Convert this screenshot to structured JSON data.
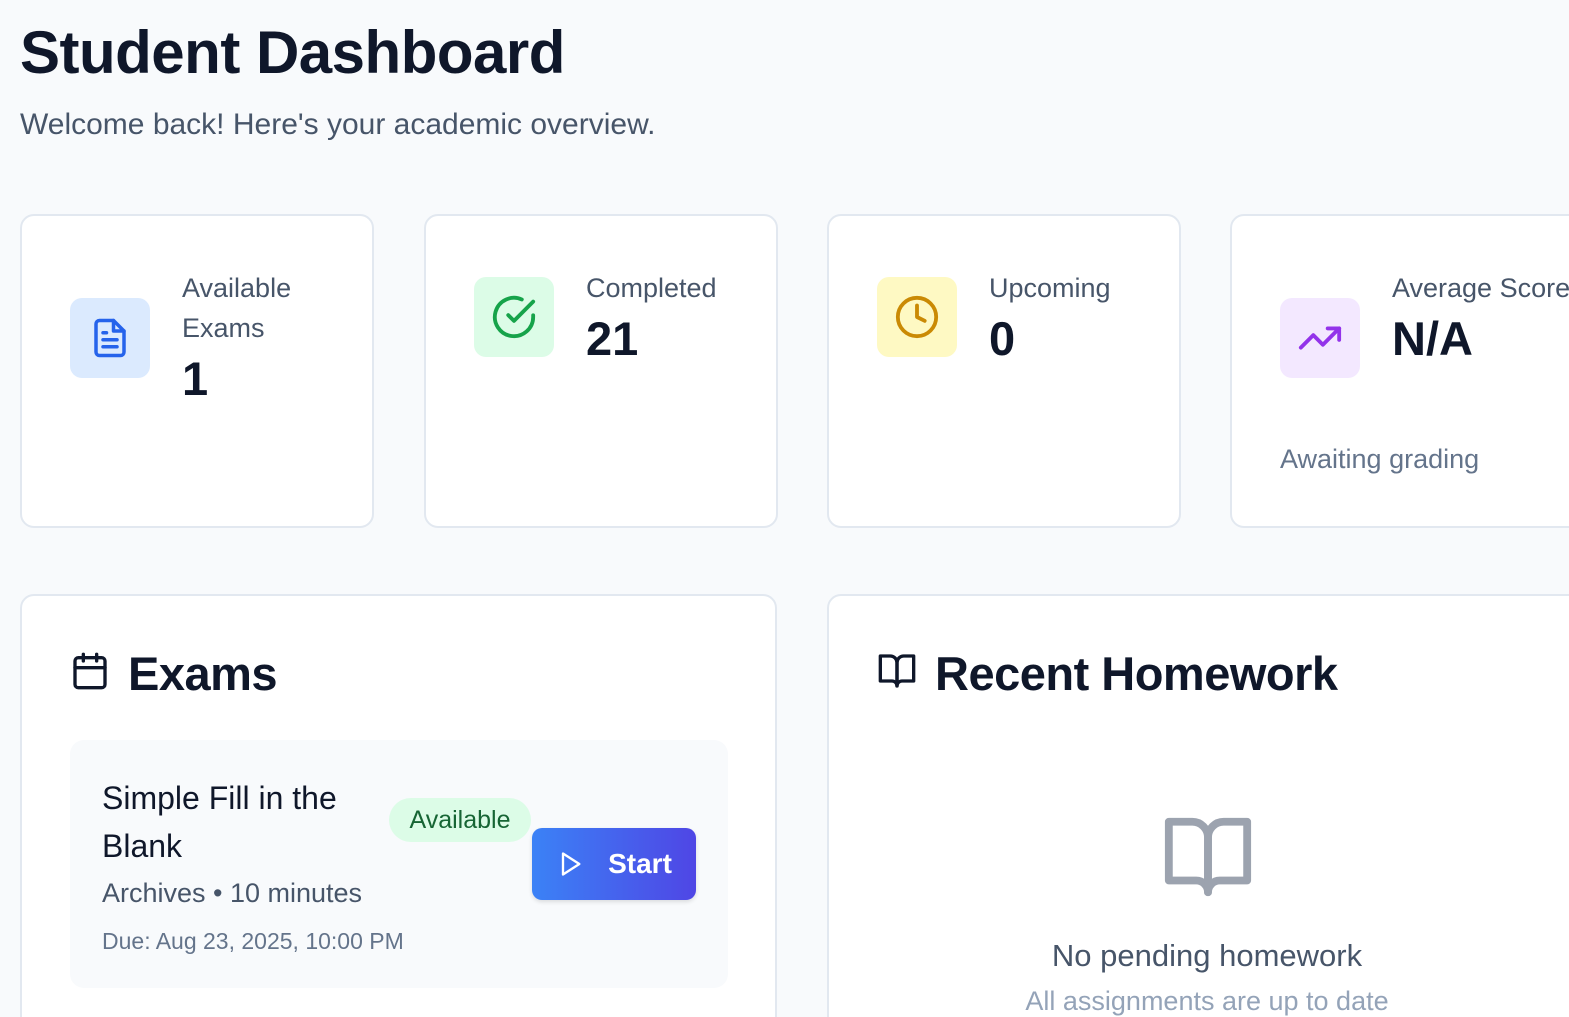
{
  "header": {
    "title": "Student Dashboard",
    "subtitle": "Welcome back! Here's your academic overview."
  },
  "stats": [
    {
      "label": "Available Exams",
      "value": "1",
      "icon": "document-icon",
      "icon_bg": "#dbeafe",
      "icon_color": "#2563eb"
    },
    {
      "label": "Completed",
      "value": "21",
      "icon": "check-circle-icon",
      "icon_bg": "#dcfce7",
      "icon_color": "#16a34a"
    },
    {
      "label": "Upcoming",
      "value": "0",
      "icon": "clock-icon",
      "icon_bg": "#fef9c3",
      "icon_color": "#ca8a04"
    },
    {
      "label": "Average Score",
      "value": "N/A",
      "note": "Awaiting grading",
      "icon": "trending-up-icon",
      "icon_bg": "#f3e8ff",
      "icon_color": "#9333ea"
    }
  ],
  "exams": {
    "title": "Exams",
    "icon": "calendar-icon",
    "items": [
      {
        "title": "Simple Fill in the Blank",
        "status": "Available",
        "meta": "Archives • 10 minutes",
        "due": "Due: Aug 23, 2025, 10:00 PM",
        "action": "Start"
      }
    ]
  },
  "homework": {
    "title": "Recent Homework",
    "icon": "book-open-icon",
    "empty_title": "No pending homework",
    "empty_subtitle": "All assignments are up to date"
  }
}
